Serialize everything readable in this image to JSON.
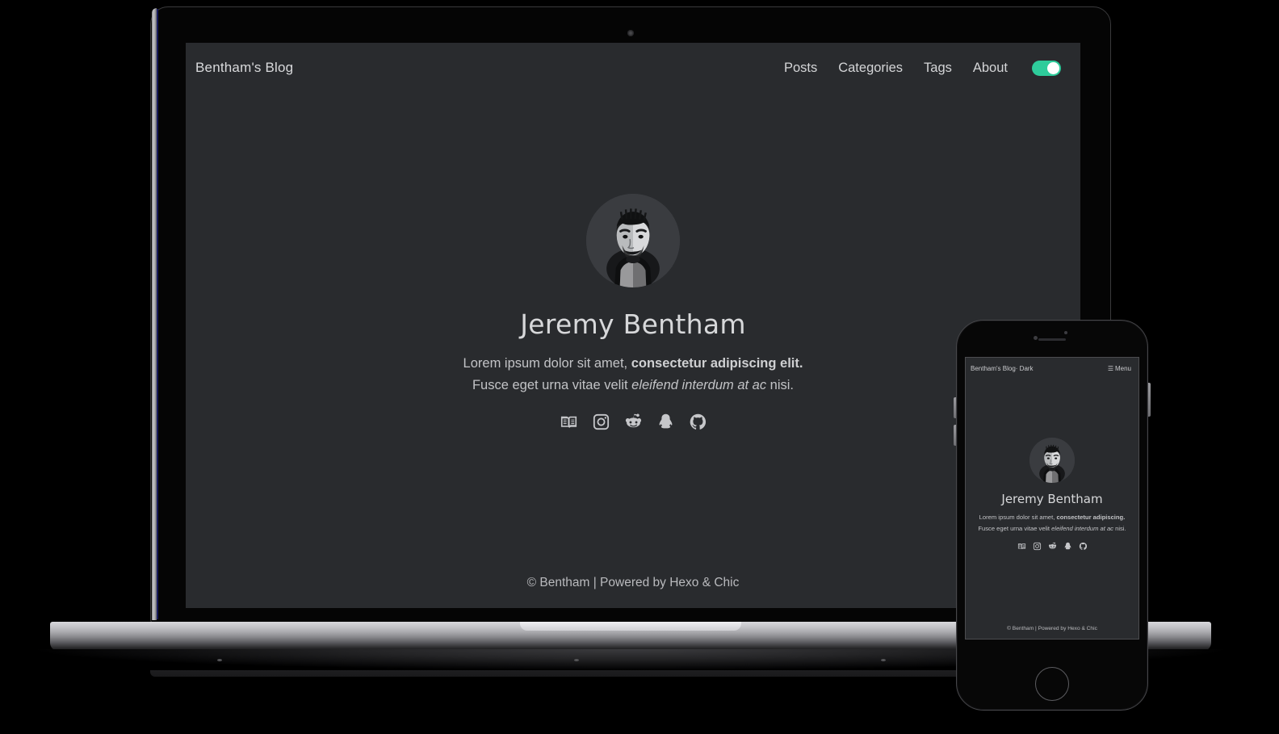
{
  "colors": {
    "page_background": "#000000",
    "site_background": "#292b2e",
    "text_primary": "#d7d8da",
    "text_secondary": "#c2c3c6",
    "toggle_accent": "#2ecc9b",
    "device_silver": "#c8c8cc"
  },
  "desktop": {
    "device_label": "MacBook",
    "nav": {
      "brand": "Bentham's Blog",
      "links": [
        {
          "label": "Posts"
        },
        {
          "label": "Categories"
        },
        {
          "label": "Tags"
        },
        {
          "label": "About"
        }
      ],
      "theme_toggle": {
        "state": "on",
        "icon": "theme-toggle-switch"
      }
    },
    "hero": {
      "avatar_alt": "avatar",
      "name": "Jeremy Bentham",
      "bio_line1_plain": "Lorem ipsum dolor sit amet, ",
      "bio_line1_bold": "consectetur adipiscing elit.",
      "bio_line2_plain_a": "Fusce eget urna vitae velit ",
      "bio_line2_italic": "eleifend interdum at ac",
      "bio_line2_plain_b": " nisi.",
      "socials": [
        {
          "name": "book-icon",
          "label": "Book"
        },
        {
          "name": "instagram-icon",
          "label": "Instagram"
        },
        {
          "name": "reddit-icon",
          "label": "Reddit"
        },
        {
          "name": "qq-icon",
          "label": "QQ"
        },
        {
          "name": "github-icon",
          "label": "GitHub"
        }
      ]
    },
    "footer": {
      "text": "© Bentham | Powered by Hexo & Chic"
    }
  },
  "mobile": {
    "nav": {
      "brand": "Bentham's Blog· Dark",
      "menu_label": "Menu",
      "menu_icon": "hamburger-icon"
    },
    "hero": {
      "name": "Jeremy Bentham",
      "bio_line1_plain": "Lorem ipsum dolor sit amet, ",
      "bio_line1_bold": "consectetur adipiscing.",
      "bio_line2_plain_a": "Fusce eget urna vitae velit ",
      "bio_line2_italic": "eleifend interdum at ac",
      "bio_line2_plain_b": " nisi.",
      "socials": [
        {
          "name": "book-icon",
          "label": "Book"
        },
        {
          "name": "instagram-icon",
          "label": "Instagram"
        },
        {
          "name": "reddit-icon",
          "label": "Reddit"
        },
        {
          "name": "qq-icon",
          "label": "QQ"
        },
        {
          "name": "github-icon",
          "label": "GitHub"
        }
      ]
    },
    "footer": {
      "text": "© Bentham | Powered by Hexo & Chic"
    }
  }
}
